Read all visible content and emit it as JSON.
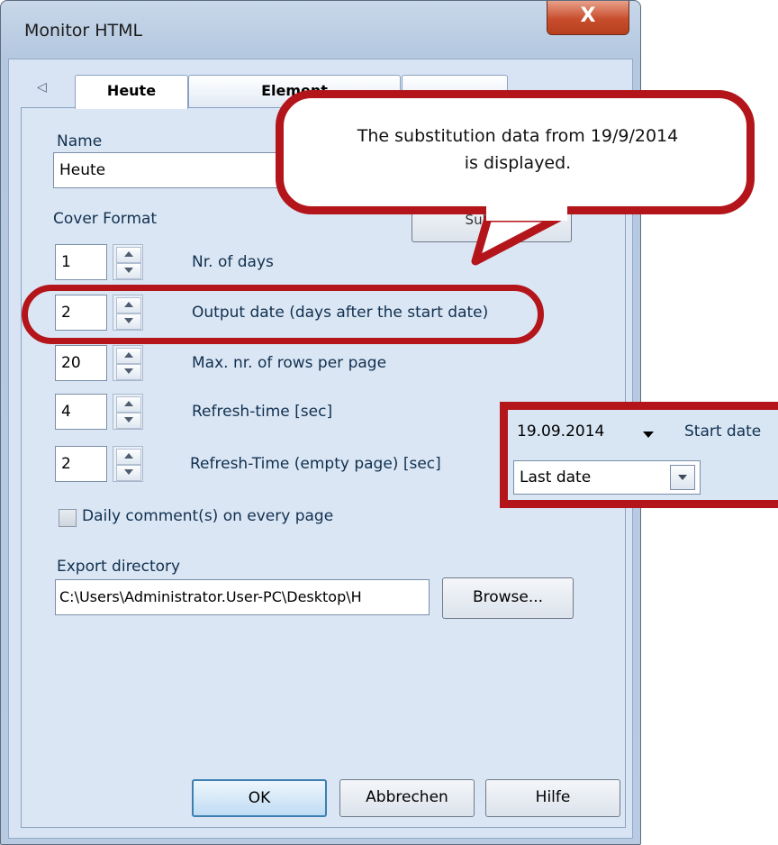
{
  "window": {
    "title": "Monitor HTML",
    "close_glyph": "X"
  },
  "tabs": [
    {
      "label": "Heute"
    },
    {
      "label": "Element"
    },
    {
      "label": ""
    }
  ],
  "tab_scroll_glyph": "◁",
  "form": {
    "name_label": "Name",
    "name_value": "Heute",
    "cover_format_label": "Cover Format",
    "partial_button_label": "Sub-Std",
    "days": {
      "value": "1",
      "label": "Nr. of days"
    },
    "output_date": {
      "value": "2",
      "label": "Output date (days after the start date)"
    },
    "max_rows": {
      "value": "20",
      "label": "Max. nr. of rows per page"
    },
    "refresh_time": {
      "value": "4",
      "label": "Refresh-time [sec]"
    },
    "refresh_empty": {
      "value": "2",
      "label": "Refresh-Time (empty page) [sec]"
    },
    "daily_comment_label": "Daily comment(s) on every page",
    "daily_comment_checked": false,
    "export_dir_label": "Export directory",
    "export_dir_value": "C:\\Users\\Administrator.User-PC\\Desktop\\H",
    "browse_label": "Browse..."
  },
  "buttons": {
    "ok": "OK",
    "cancel": "Abbrechen",
    "help": "Hilfe"
  },
  "annotation": {
    "balloon_line1": "The substitution data from 19/9/2014",
    "balloon_line2": "is displayed."
  },
  "date_callout": {
    "start_date_value": "19.09.2014",
    "start_date_label": "Start date",
    "date_mode_value": "Last date"
  },
  "colors": {
    "annotation_red": "#b3151a",
    "window_blue": "#c9d8ea",
    "panel_blue": "#dbe6f4"
  }
}
